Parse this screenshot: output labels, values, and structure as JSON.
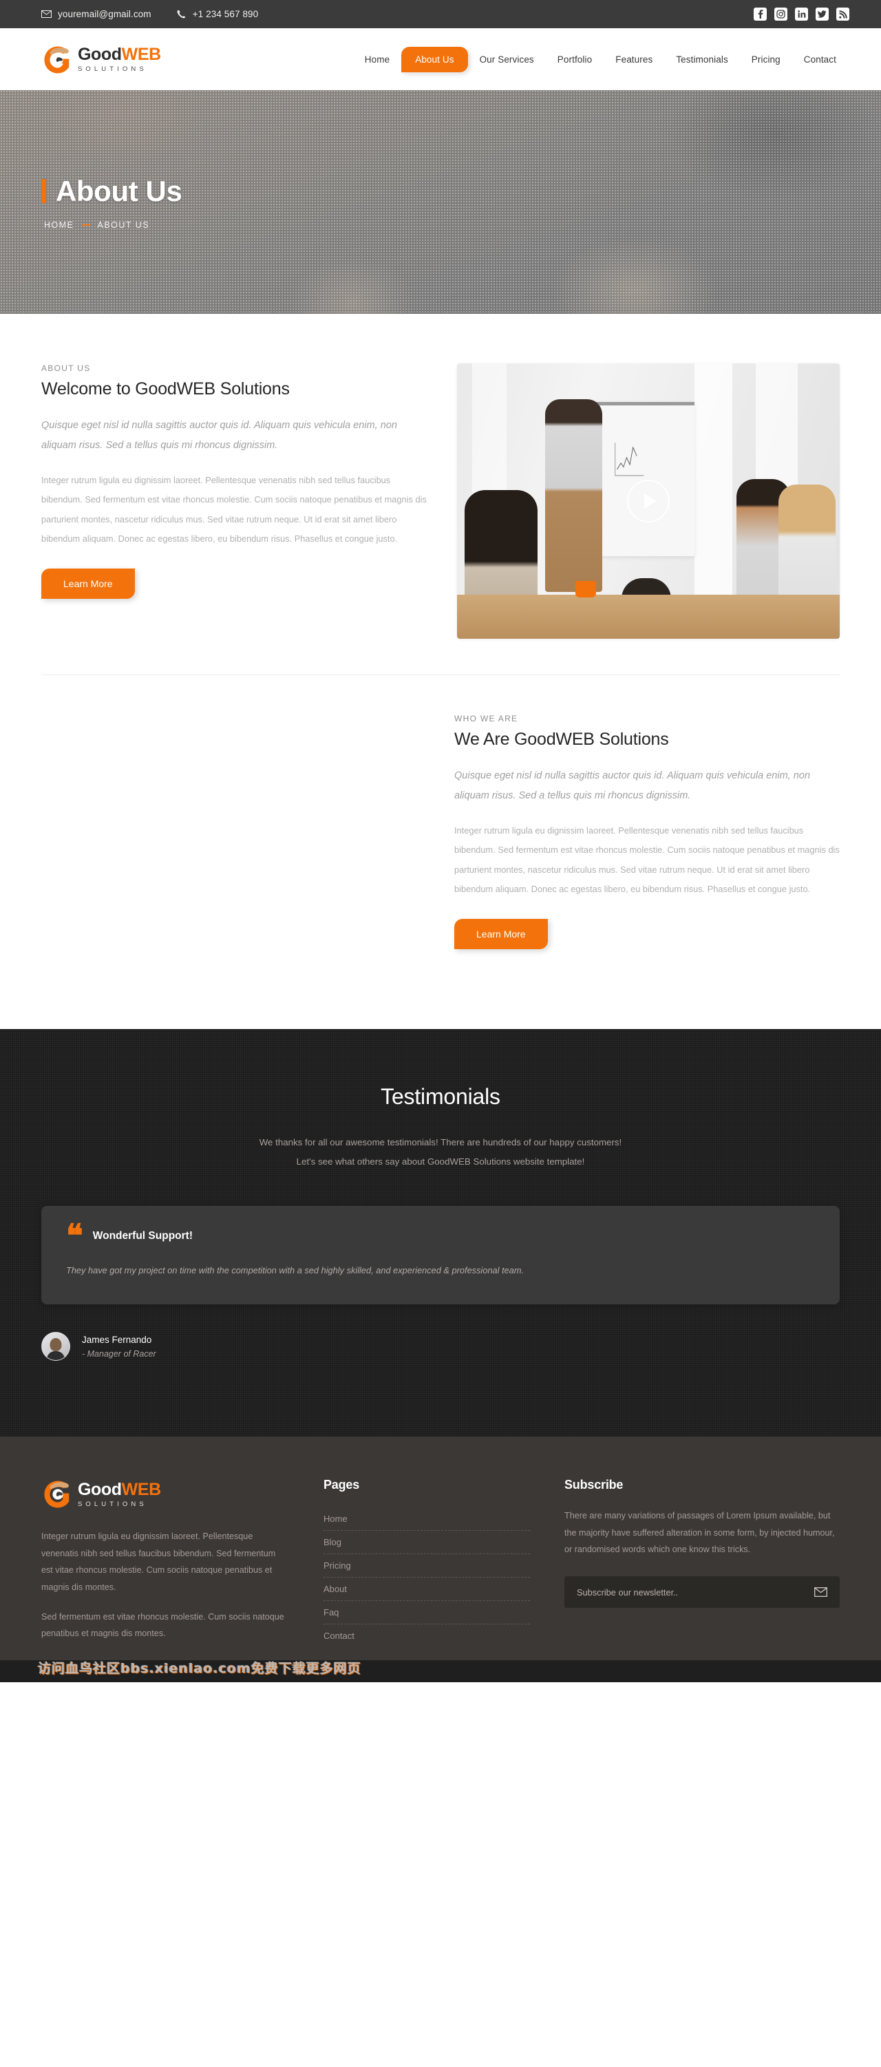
{
  "topbar": {
    "email": "youremail@gmail.com",
    "phone": "+1 234 567 890",
    "socials": [
      {
        "name": "facebook-icon",
        "label": "f"
      },
      {
        "name": "instagram-icon",
        "label": "◎"
      },
      {
        "name": "linkedin-icon",
        "label": "in"
      },
      {
        "name": "twitter-icon",
        "label": "t"
      },
      {
        "name": "rss-icon",
        "label": "r"
      }
    ]
  },
  "logo": {
    "good": "Good",
    "web": "WEB",
    "sub": "SOLUTIONS"
  },
  "nav": {
    "items": [
      {
        "label": "Home",
        "active": false
      },
      {
        "label": "About Us",
        "active": true
      },
      {
        "label": "Our Services",
        "active": false
      },
      {
        "label": "Portfolio",
        "active": false
      },
      {
        "label": "Features",
        "active": false
      },
      {
        "label": "Testimonials",
        "active": false
      },
      {
        "label": "Pricing",
        "active": false
      },
      {
        "label": "Contact",
        "active": false
      }
    ]
  },
  "hero": {
    "title": "About Us",
    "breadcrumb_home": "HOME",
    "breadcrumb_current": "ABOUT US"
  },
  "about": {
    "eyebrow": "ABOUT US",
    "heading": "Welcome to GoodWEB Solutions",
    "lead": "Quisque eget nisl id nulla sagittis auctor quis id. Aliquam quis vehicula enim, non aliquam risus. Sed a tellus quis mi rhoncus dignissim.",
    "body": "Integer rutrum ligula eu dignissim laoreet. Pellentesque venenatis nibh sed tellus faucibus bibendum. Sed fermentum est vitae rhoncus molestie. Cum sociis natoque penatibus et magnis dis parturient montes, nascetur ridiculus mus. Sed vitae rutrum neque. Ut id erat sit amet libero bibendum aliquam. Donec ac egestas libero, eu bibendum risus. Phasellus et congue justo.",
    "button": "Learn More"
  },
  "who": {
    "eyebrow": "WHO WE ARE",
    "heading": "We Are GoodWEB Solutions",
    "lead": "Quisque eget nisl id nulla sagittis auctor quis id. Aliquam quis vehicula enim, non aliquam risus. Sed a tellus quis mi rhoncus dignissim.",
    "body": "Integer rutrum ligula eu dignissim laoreet. Pellentesque venenatis nibh sed tellus faucibus bibendum. Sed fermentum est vitae rhoncus molestie. Cum sociis natoque penatibus et magnis dis parturient montes, nascetur ridiculus mus. Sed vitae rutrum neque. Ut id erat sit amet libero bibendum aliquam. Donec ac egestas libero, eu bibendum risus. Phasellus et congue justo.",
    "button": "Learn More"
  },
  "testimonials": {
    "title": "Testimonials",
    "sub_line1": "We thanks for all our awesome testimonials! There are hundreds of our happy customers!",
    "sub_line2": "Let's see what others say about GoodWEB Solutions website template!",
    "quote_glyph": "❝",
    "card_title": "Wonderful Support!",
    "card_body": "They have got my project on time with the competition with a sed highly skilled, and experienced & professional team.",
    "author_name": "James Fernando",
    "author_role": "- Manager of Racer"
  },
  "footer": {
    "about_p1": "Integer rutrum ligula eu dignissim laoreet. Pellentesque venenatis nibh sed tellus faucibus bibendum. Sed fermentum est vitae rhoncus molestie. Cum sociis natoque penatibus et magnis dis montes.",
    "about_p2": "Sed fermentum est vitae rhoncus molestie. Cum sociis natoque penatibus et magnis dis montes.",
    "pages_title": "Pages",
    "pages": [
      "Home",
      "Blog",
      "Pricing",
      "About",
      "Faq",
      "Contact"
    ],
    "subscribe_title": "Subscribe",
    "subscribe_text": "There are many variations of passages of Lorem Ipsum available, but the majority have suffered alteration in some form, by injected humour, or randomised words which one know this tricks.",
    "subscribe_placeholder": "Subscribe our newsletter..",
    "subscribe_value": ""
  },
  "watermark": "访问血鸟社区bbs.xienlao.com免费下载更多网页",
  "colors": {
    "accent": "#f4720b",
    "topbar_bg": "#3b3b3b",
    "dark_section": "#1d1d1d",
    "footer_bg": "#3b3836",
    "card_bg": "#3a3a3a",
    "carousel_btn": "#d5a06a"
  }
}
